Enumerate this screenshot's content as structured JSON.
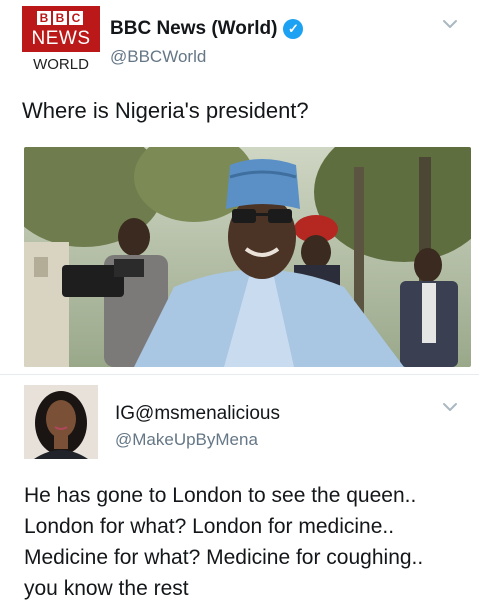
{
  "tweet": {
    "logo": {
      "letters": [
        "B",
        "B",
        "C"
      ],
      "top": "NEWS",
      "bottom": "WORLD",
      "brand_color": "#bb1919"
    },
    "author_name": "BBC News (World)",
    "verified_icon": "verified-badge-icon",
    "handle": "@BBCWorld",
    "text": "Where is Nigeria's president?",
    "menu_icon": "chevron-down-icon"
  },
  "reply": {
    "author_name": "IG@msmenalicious",
    "handle": "@MakeUpByMena",
    "menu_icon": "chevron-down-icon",
    "lines": [
      "He has gone to London to see the queen..",
      "London for what? London for medicine..",
      "Medicine for what? Medicine for coughing..",
      "you know the rest"
    ]
  },
  "colors": {
    "text": "#14171a",
    "secondary": "#657786",
    "verified": "#1da1f2"
  }
}
